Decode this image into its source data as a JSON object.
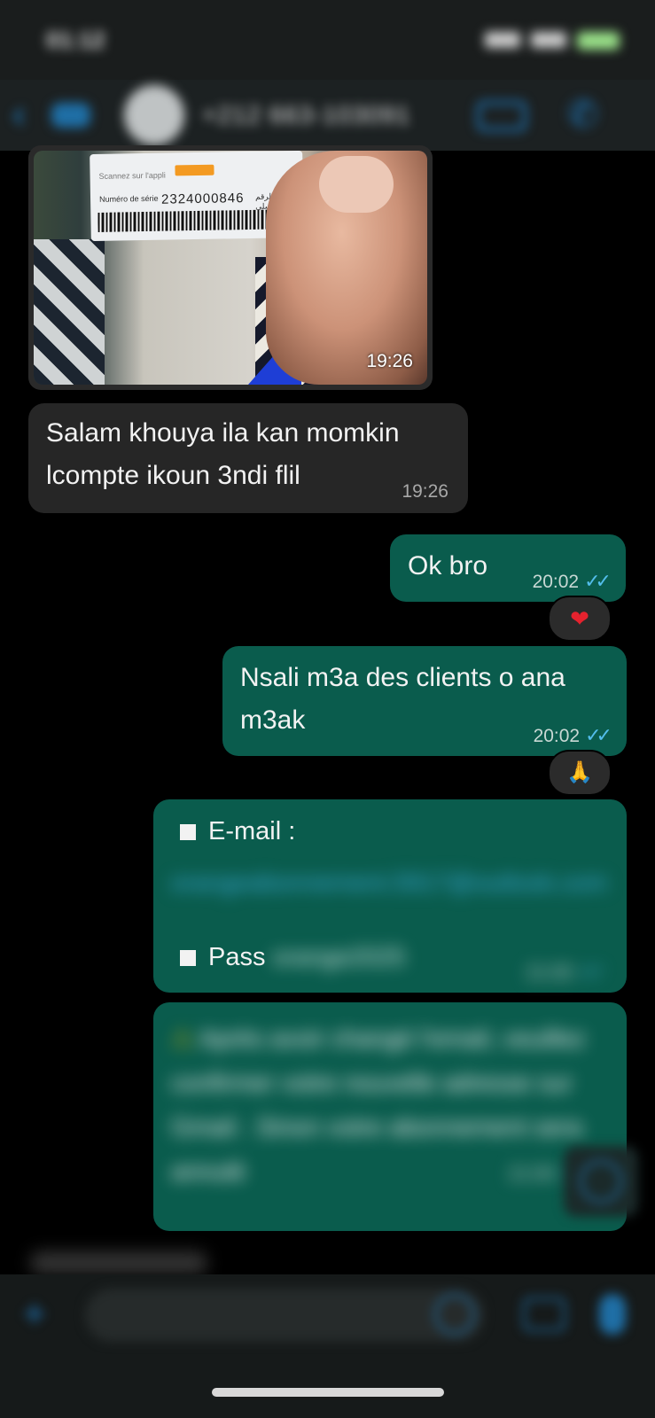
{
  "status_bar": {
    "time": "01:12"
  },
  "header": {
    "back_icon": "chevron-left-icon",
    "contact_name": "+212 663-103091",
    "video_icon": "video-call-icon",
    "phone_icon": "phone-icon"
  },
  "messages": [
    {
      "type": "image",
      "direction": "incoming",
      "card": {
        "top_text": "Scannez sur l'appli",
        "badge": "Orange et moi",
        "label": "Numéro de série",
        "serial": "2324000846",
        "arabic": "الرقم التسلسلي"
      },
      "time": "19:26"
    },
    {
      "type": "text",
      "direction": "incoming",
      "line1": "Salam khouya ila kan momkin",
      "line2": "lcompte ikoun 3ndi flil",
      "time": "19:26"
    },
    {
      "type": "text",
      "direction": "outgoing",
      "text": "Ok bro",
      "time": "20:02",
      "ticks": "✓✓",
      "reaction": "❤"
    },
    {
      "type": "text",
      "direction": "outgoing",
      "line1": "Nsali m3a des clients o ana",
      "line2": "m3ak",
      "time": "20:02",
      "ticks": "✓✓",
      "reaction": "🙏"
    },
    {
      "type": "credentials",
      "direction": "outgoing",
      "email_label": "E-mail :",
      "email_value": "orangeabonnement.5917@outlook.com",
      "pass_label": "Pass",
      "pass_value": "orange2025",
      "time": "21:00",
      "ticks": "✓✓"
    },
    {
      "type": "text",
      "direction": "outgoing",
      "icon": "⚠",
      "text": "Après avoir changé l'email, veuillez confirmer votre nouvelle adresse sur Gmail . Sinon votre abonnement sera annulé",
      "time": "21:00",
      "ticks": "✓✓"
    }
  ],
  "composer": {
    "placeholder": "",
    "plus_icon": "plus-icon",
    "sticker_icon": "sticker-icon",
    "camera_icon": "camera-icon",
    "mic_icon": "microphone-icon"
  },
  "colors": {
    "background": "#000000",
    "incoming_bubble": "#262626",
    "outgoing_bubble": "#0a5c4d",
    "accent": "#1f7bc0",
    "read_ticks": "#53bdeb"
  }
}
